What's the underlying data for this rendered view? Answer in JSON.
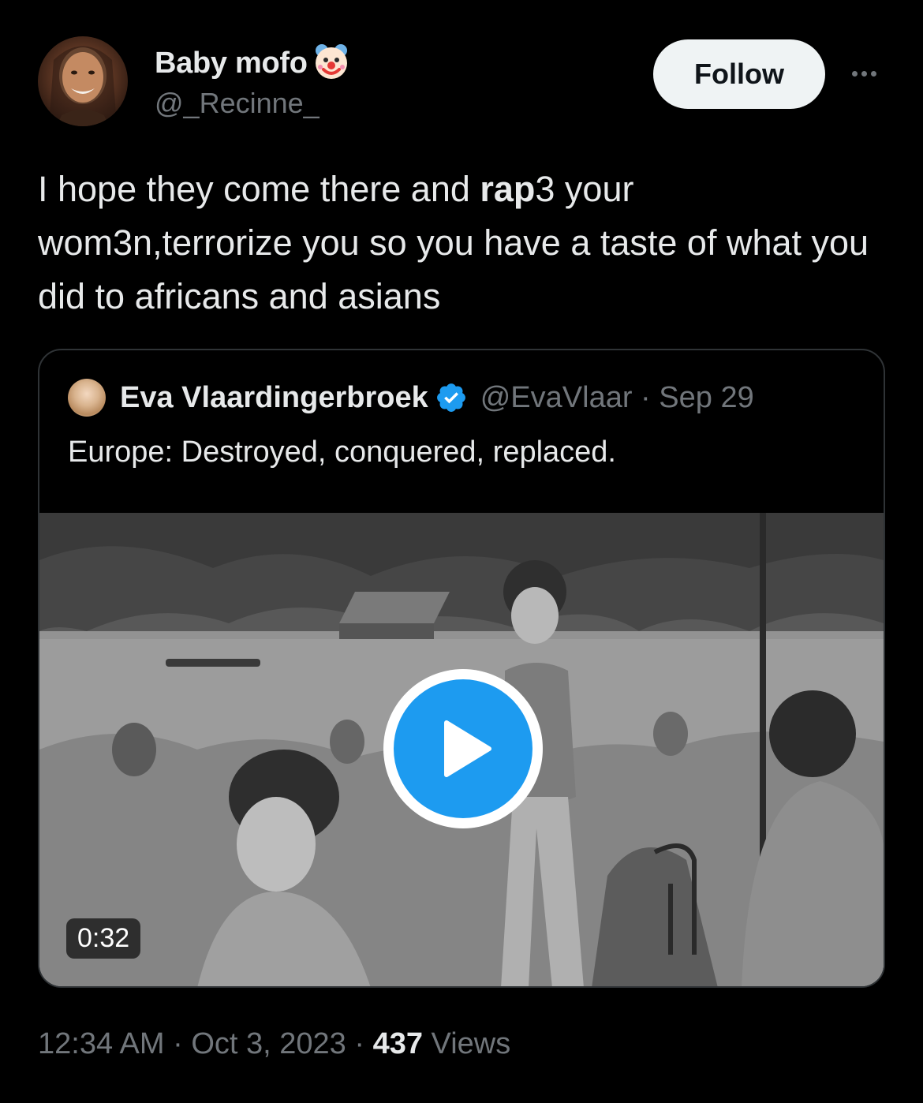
{
  "author": {
    "display_name": "Baby mofo",
    "name_emoji": "clown-face-icon",
    "handle": "@_Recinne_",
    "avatar": "avatar-photo"
  },
  "follow_label": "Follow",
  "more_icon": "more-horizontal-icon",
  "tweet": {
    "text_part1": "I hope they come there and ",
    "text_bold": "rap",
    "text_part2": "3 your wom3n,terrorize you so you have a taste of what you did to africans and asians"
  },
  "quote": {
    "name": "Eva Vlaardingerbroek",
    "verified_icon": "verified-badge-icon",
    "handle_date": "@EvaVlaar · Sep 29",
    "text": "Europe: Destroyed, conquered, replaced.",
    "video_duration": "0:32",
    "play_icon": "play-icon"
  },
  "meta": {
    "time": "12:34 AM",
    "sep1": " · ",
    "date": "Oct 3, 2023",
    "sep2": " · ",
    "views_count": "437",
    "views_label": " Views"
  },
  "colors": {
    "background": "#000000",
    "text": "#e7e9ea",
    "secondary": "#71767b",
    "accent": "#1d9bf0",
    "border": "#2f3336"
  }
}
